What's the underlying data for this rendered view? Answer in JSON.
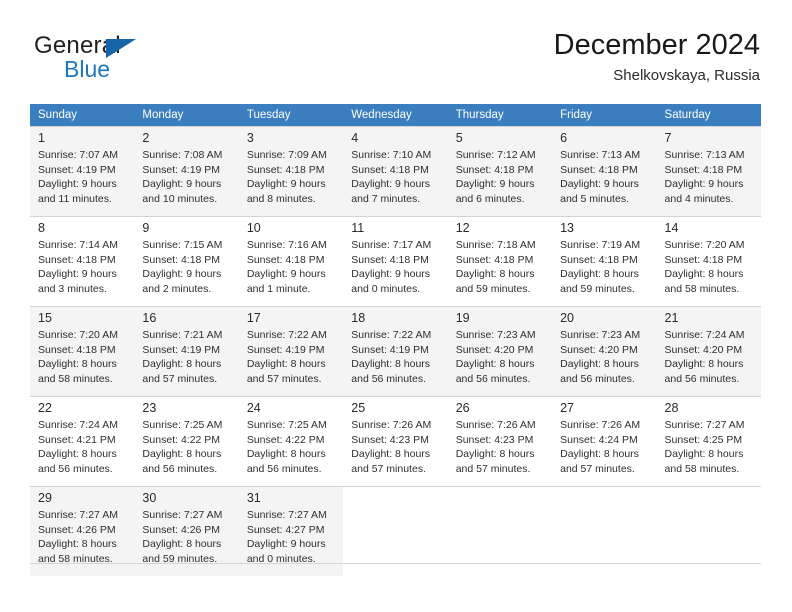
{
  "brand": {
    "name_part1": "General",
    "name_part2": "Blue",
    "flag_icon": "triangle-flag-icon",
    "accent_color": "#1565a8",
    "blue_text_color": "#1f77bd"
  },
  "header": {
    "title": "December 2024",
    "subtitle": "Shelkovskaya, Russia"
  },
  "calendar": {
    "header_bg": "#3b7ebf",
    "weekday_headers": [
      "Sunday",
      "Monday",
      "Tuesday",
      "Wednesday",
      "Thursday",
      "Friday",
      "Saturday"
    ],
    "weeks": [
      {
        "shaded": true,
        "days": [
          {
            "day": "1",
            "info": "Sunrise: 7:07 AM\nSunset: 4:19 PM\nDaylight: 9 hours\nand 11 minutes."
          },
          {
            "day": "2",
            "info": "Sunrise: 7:08 AM\nSunset: 4:19 PM\nDaylight: 9 hours\nand 10 minutes."
          },
          {
            "day": "3",
            "info": "Sunrise: 7:09 AM\nSunset: 4:18 PM\nDaylight: 9 hours\nand 8 minutes."
          },
          {
            "day": "4",
            "info": "Sunrise: 7:10 AM\nSunset: 4:18 PM\nDaylight: 9 hours\nand 7 minutes."
          },
          {
            "day": "5",
            "info": "Sunrise: 7:12 AM\nSunset: 4:18 PM\nDaylight: 9 hours\nand 6 minutes."
          },
          {
            "day": "6",
            "info": "Sunrise: 7:13 AM\nSunset: 4:18 PM\nDaylight: 9 hours\nand 5 minutes."
          },
          {
            "day": "7",
            "info": "Sunrise: 7:13 AM\nSunset: 4:18 PM\nDaylight: 9 hours\nand 4 minutes."
          }
        ]
      },
      {
        "shaded": false,
        "days": [
          {
            "day": "8",
            "info": "Sunrise: 7:14 AM\nSunset: 4:18 PM\nDaylight: 9 hours\nand 3 minutes."
          },
          {
            "day": "9",
            "info": "Sunrise: 7:15 AM\nSunset: 4:18 PM\nDaylight: 9 hours\nand 2 minutes."
          },
          {
            "day": "10",
            "info": "Sunrise: 7:16 AM\nSunset: 4:18 PM\nDaylight: 9 hours\nand 1 minute."
          },
          {
            "day": "11",
            "info": "Sunrise: 7:17 AM\nSunset: 4:18 PM\nDaylight: 9 hours\nand 0 minutes."
          },
          {
            "day": "12",
            "info": "Sunrise: 7:18 AM\nSunset: 4:18 PM\nDaylight: 8 hours\nand 59 minutes."
          },
          {
            "day": "13",
            "info": "Sunrise: 7:19 AM\nSunset: 4:18 PM\nDaylight: 8 hours\nand 59 minutes."
          },
          {
            "day": "14",
            "info": "Sunrise: 7:20 AM\nSunset: 4:18 PM\nDaylight: 8 hours\nand 58 minutes."
          }
        ]
      },
      {
        "shaded": true,
        "days": [
          {
            "day": "15",
            "info": "Sunrise: 7:20 AM\nSunset: 4:18 PM\nDaylight: 8 hours\nand 58 minutes."
          },
          {
            "day": "16",
            "info": "Sunrise: 7:21 AM\nSunset: 4:19 PM\nDaylight: 8 hours\nand 57 minutes."
          },
          {
            "day": "17",
            "info": "Sunrise: 7:22 AM\nSunset: 4:19 PM\nDaylight: 8 hours\nand 57 minutes."
          },
          {
            "day": "18",
            "info": "Sunrise: 7:22 AM\nSunset: 4:19 PM\nDaylight: 8 hours\nand 56 minutes."
          },
          {
            "day": "19",
            "info": "Sunrise: 7:23 AM\nSunset: 4:20 PM\nDaylight: 8 hours\nand 56 minutes."
          },
          {
            "day": "20",
            "info": "Sunrise: 7:23 AM\nSunset: 4:20 PM\nDaylight: 8 hours\nand 56 minutes."
          },
          {
            "day": "21",
            "info": "Sunrise: 7:24 AM\nSunset: 4:20 PM\nDaylight: 8 hours\nand 56 minutes."
          }
        ]
      },
      {
        "shaded": false,
        "days": [
          {
            "day": "22",
            "info": "Sunrise: 7:24 AM\nSunset: 4:21 PM\nDaylight: 8 hours\nand 56 minutes."
          },
          {
            "day": "23",
            "info": "Sunrise: 7:25 AM\nSunset: 4:22 PM\nDaylight: 8 hours\nand 56 minutes."
          },
          {
            "day": "24",
            "info": "Sunrise: 7:25 AM\nSunset: 4:22 PM\nDaylight: 8 hours\nand 56 minutes."
          },
          {
            "day": "25",
            "info": "Sunrise: 7:26 AM\nSunset: 4:23 PM\nDaylight: 8 hours\nand 57 minutes."
          },
          {
            "day": "26",
            "info": "Sunrise: 7:26 AM\nSunset: 4:23 PM\nDaylight: 8 hours\nand 57 minutes."
          },
          {
            "day": "27",
            "info": "Sunrise: 7:26 AM\nSunset: 4:24 PM\nDaylight: 8 hours\nand 57 minutes."
          },
          {
            "day": "28",
            "info": "Sunrise: 7:27 AM\nSunset: 4:25 PM\nDaylight: 8 hours\nand 58 minutes."
          }
        ]
      },
      {
        "shaded": true,
        "days": [
          {
            "day": "29",
            "info": "Sunrise: 7:27 AM\nSunset: 4:26 PM\nDaylight: 8 hours\nand 58 minutes."
          },
          {
            "day": "30",
            "info": "Sunrise: 7:27 AM\nSunset: 4:26 PM\nDaylight: 8 hours\nand 59 minutes."
          },
          {
            "day": "31",
            "info": "Sunrise: 7:27 AM\nSunset: 4:27 PM\nDaylight: 9 hours\nand 0 minutes."
          },
          {
            "day": "",
            "info": ""
          },
          {
            "day": "",
            "info": ""
          },
          {
            "day": "",
            "info": ""
          },
          {
            "day": "",
            "info": ""
          }
        ]
      }
    ]
  }
}
